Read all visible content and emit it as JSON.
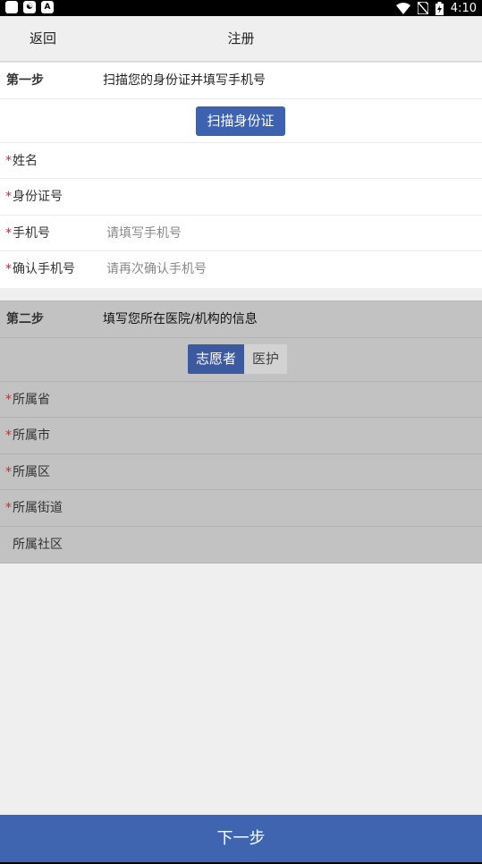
{
  "status_bar": {
    "time": "4:10",
    "left_icons": [
      "app-notification-icon",
      "incognito-icon",
      "a-letter-icon"
    ],
    "a_label": "A",
    "right_icons": [
      "wifi-icon",
      "no-sim-icon",
      "battery-charging-icon"
    ]
  },
  "app_bar": {
    "back_label": "返回",
    "title": "注册"
  },
  "step1": {
    "label": "第一步",
    "description": "扫描您的身份证并填写手机号",
    "scan_button": "扫描身份证",
    "fields": [
      {
        "label": "姓名",
        "required": "*",
        "value": ""
      },
      {
        "label": "身份证号",
        "required": "*",
        "value": ""
      },
      {
        "label": "手机号",
        "required": "*",
        "placeholder": "请填写手机号"
      },
      {
        "label": "确认手机号",
        "required": "*",
        "placeholder": "请再次确认手机号"
      }
    ]
  },
  "step2": {
    "label": "第二步",
    "description": "填写您所在医院/机构的信息",
    "segments": [
      "志愿者",
      "医护"
    ],
    "selected_segment": "志愿者",
    "fields": [
      {
        "label": "所属省",
        "required": "*"
      },
      {
        "label": "所属市",
        "required": "*"
      },
      {
        "label": "所属区",
        "required": "*"
      },
      {
        "label": "所属街道",
        "required": "*"
      },
      {
        "label": "所属社区",
        "required": ""
      }
    ]
  },
  "next_button": "下一步",
  "colors": {
    "primary": "#4065b0",
    "segment_active": "#3d5aa0",
    "required": "#e02020",
    "disabled_section_bg": "#c2c2c2"
  }
}
